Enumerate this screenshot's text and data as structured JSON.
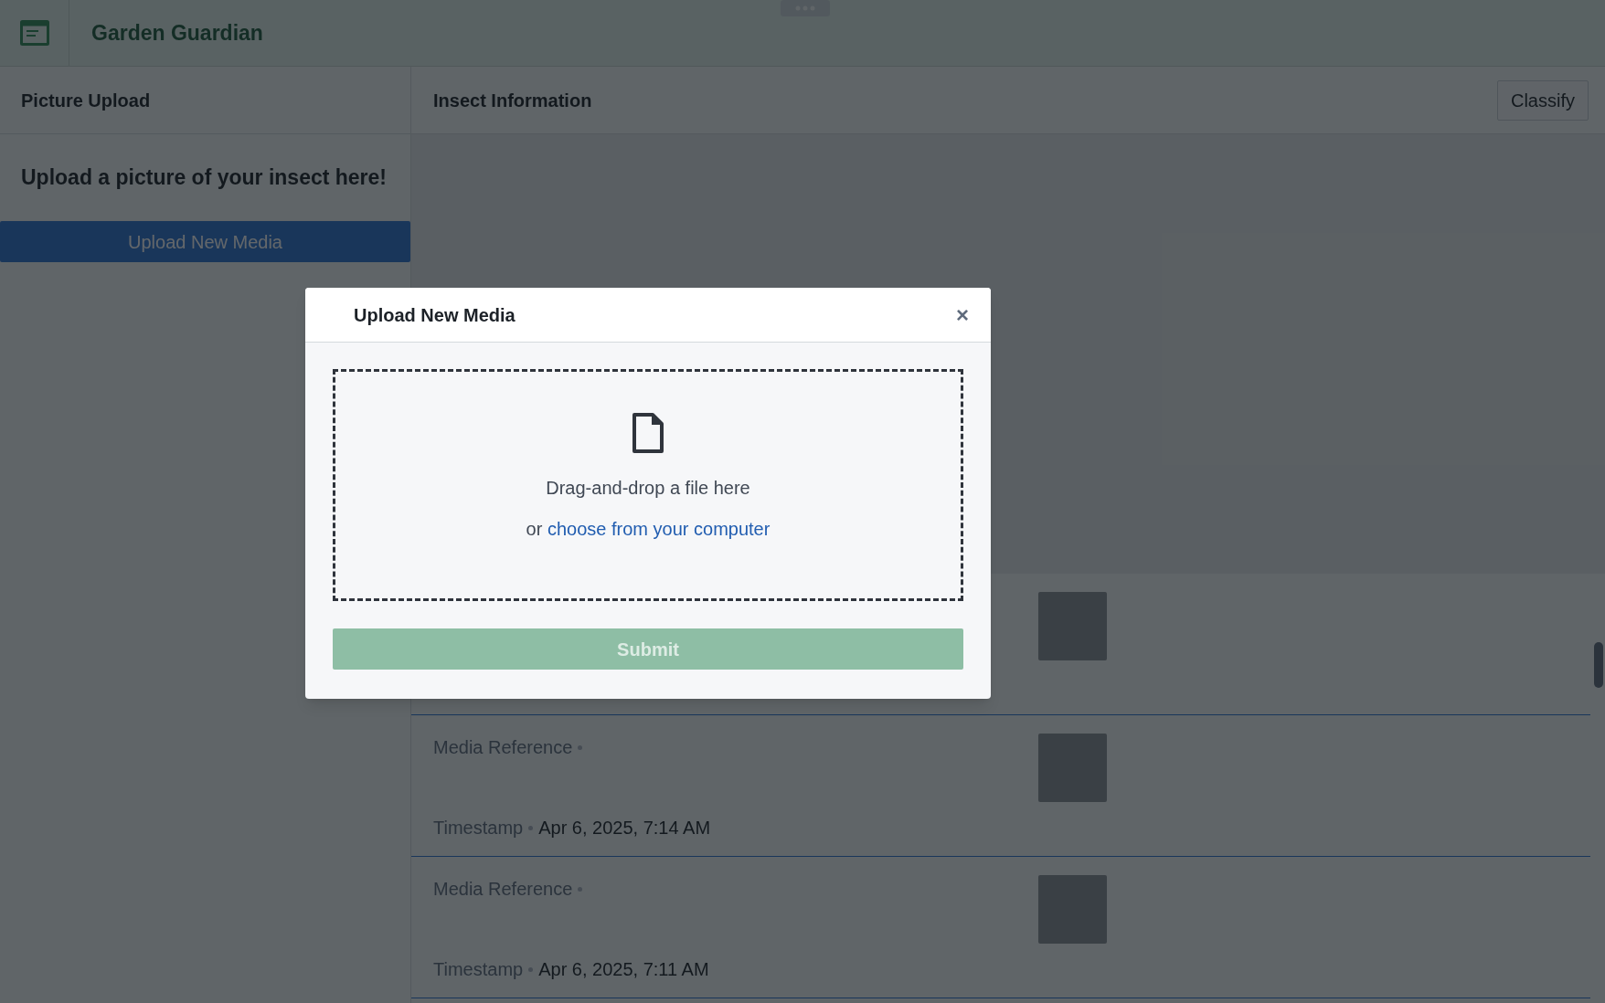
{
  "app": {
    "title": "Garden Guardian"
  },
  "left_panel": {
    "title": "Picture Upload",
    "heading": "Upload a picture of your insect here!",
    "button": "Upload New Media"
  },
  "right_panel": {
    "title": "Insect Information",
    "button": "Classify",
    "rows": [
      {},
      {
        "media_label": "Media Reference",
        "timestamp_label": "Timestamp",
        "timestamp": "Apr 6, 2025, 7:14 AM"
      },
      {
        "media_label": "Media Reference",
        "timestamp_label": "Timestamp",
        "timestamp": "Apr 6, 2025, 7:11 AM"
      }
    ]
  },
  "dialog": {
    "title": "Upload New Media",
    "close": "×",
    "drop_text": "Drag-and-drop a file here",
    "or_text": "or",
    "link": "choose from your computer",
    "submit": "Submit",
    "submit_disabled": true
  }
}
